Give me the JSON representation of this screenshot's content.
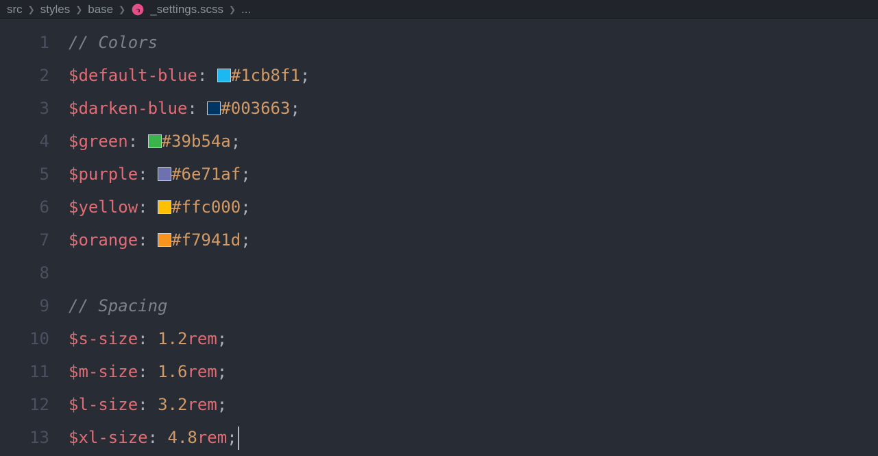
{
  "breadcrumb": {
    "items": [
      "src",
      "styles",
      "base",
      "_settings.scss",
      "..."
    ]
  },
  "code": {
    "lines": [
      {
        "num": "1",
        "type": "comment",
        "text": "// Colors"
      },
      {
        "num": "2",
        "type": "color",
        "var": "$default-blue",
        "val": "#1cb8f1",
        "swatch": "#1cb8f1"
      },
      {
        "num": "3",
        "type": "color",
        "var": "$darken-blue",
        "val": "#003663",
        "swatch": "#003663"
      },
      {
        "num": "4",
        "type": "color",
        "var": "$green",
        "val": "#39b54a",
        "swatch": "#39b54a"
      },
      {
        "num": "5",
        "type": "color",
        "var": "$purple",
        "val": "#6e71af",
        "swatch": "#6e71af"
      },
      {
        "num": "6",
        "type": "color",
        "var": "$yellow",
        "val": "#ffc000",
        "swatch": "#ffc000"
      },
      {
        "num": "7",
        "type": "color",
        "var": "$orange",
        "val": "#f7941d",
        "swatch": "#f7941d"
      },
      {
        "num": "8",
        "type": "blank"
      },
      {
        "num": "9",
        "type": "comment",
        "text": "// Spacing"
      },
      {
        "num": "10",
        "type": "size",
        "var": "$s-size",
        "num_val": "1.2",
        "unit": "rem"
      },
      {
        "num": "11",
        "type": "size",
        "var": "$m-size",
        "num_val": "1.6",
        "unit": "rem"
      },
      {
        "num": "12",
        "type": "size",
        "var": "$l-size",
        "num_val": "3.2",
        "unit": "rem"
      },
      {
        "num": "13",
        "type": "size",
        "var": "$xl-size",
        "num_val": "4.8",
        "unit": "rem",
        "cursor": true
      }
    ]
  }
}
